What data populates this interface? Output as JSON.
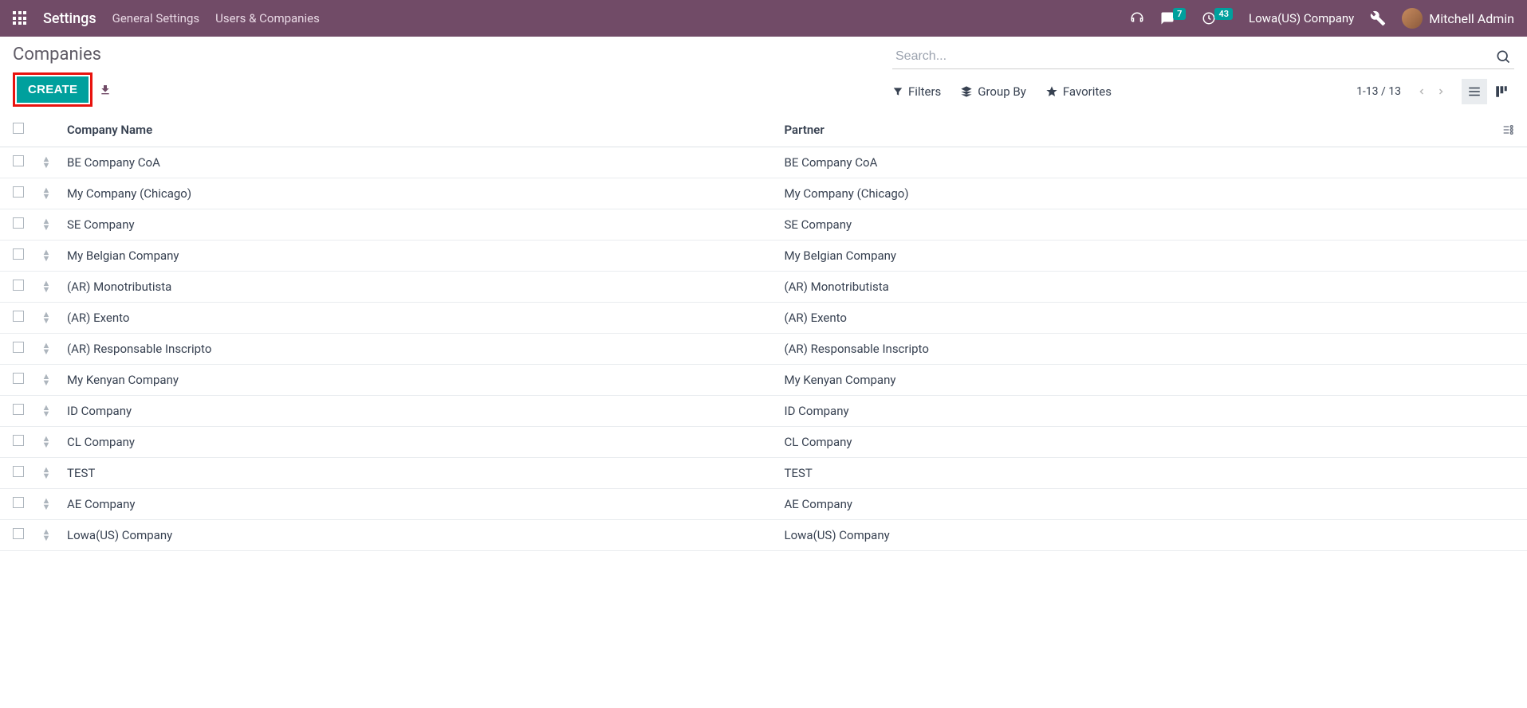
{
  "navbar": {
    "title": "Settings",
    "links": [
      "General Settings",
      "Users & Companies"
    ],
    "messages_badge": "7",
    "activities_badge": "43",
    "company": "Lowa(US) Company",
    "user": "Mitchell Admin"
  },
  "breadcrumb": "Companies",
  "buttons": {
    "create": "CREATE"
  },
  "search": {
    "placeholder": "Search..."
  },
  "filters": {
    "filters": "Filters",
    "groupby": "Group By",
    "favorites": "Favorites"
  },
  "pager": "1-13 / 13",
  "columns": {
    "name": "Company Name",
    "partner": "Partner"
  },
  "rows": [
    {
      "name": "BE Company CoA",
      "partner": "BE Company CoA"
    },
    {
      "name": "My Company (Chicago)",
      "partner": "My Company (Chicago)"
    },
    {
      "name": "SE Company",
      "partner": "SE Company"
    },
    {
      "name": "My Belgian Company",
      "partner": "My Belgian Company"
    },
    {
      "name": "(AR) Monotributista",
      "partner": "(AR) Monotributista"
    },
    {
      "name": "(AR) Exento",
      "partner": "(AR) Exento"
    },
    {
      "name": "(AR) Responsable Inscripto",
      "partner": "(AR) Responsable Inscripto"
    },
    {
      "name": "My Kenyan Company",
      "partner": "My Kenyan Company"
    },
    {
      "name": "ID Company",
      "partner": "ID Company"
    },
    {
      "name": "CL Company",
      "partner": "CL Company"
    },
    {
      "name": "TEST",
      "partner": "TEST"
    },
    {
      "name": "AE Company",
      "partner": "AE Company"
    },
    {
      "name": "Lowa(US) Company",
      "partner": "Lowa(US) Company"
    }
  ]
}
